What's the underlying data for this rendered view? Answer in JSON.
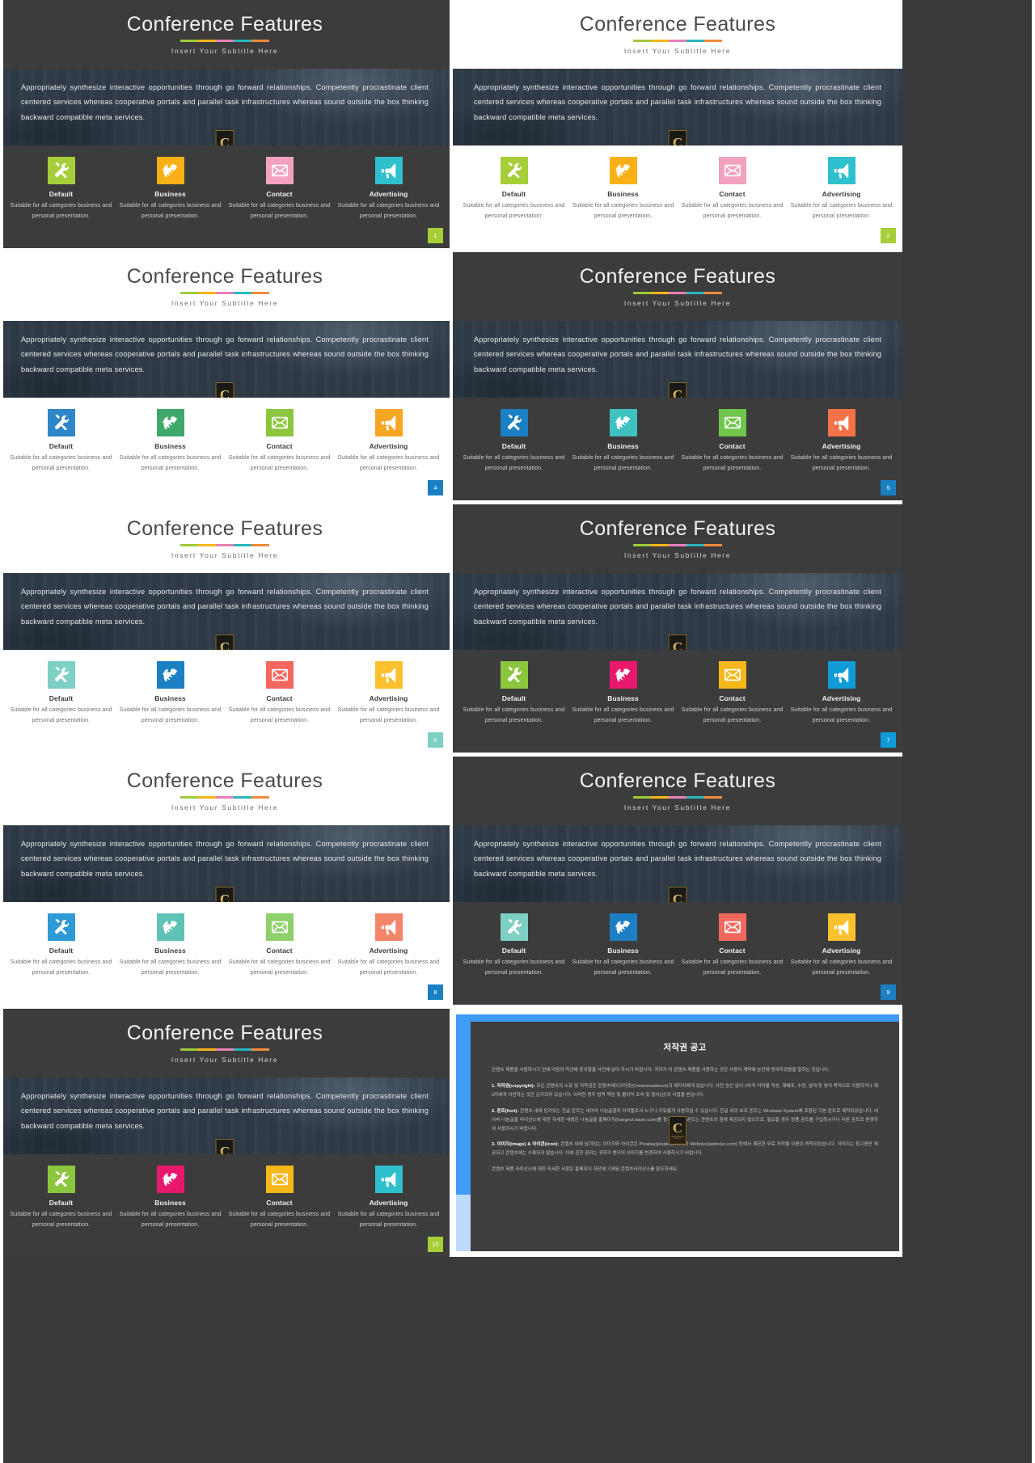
{
  "deck": {
    "title": "Conference Features",
    "subtitle": "Insert Your Subtitle Here",
    "paragraph": "Appropriately synthesize interactive opportunities through go forward relationships. Competently procrastinate client centered services whereas cooperative portals and parallel task infrastructures whereas sound outside the box thinking backward compatible meta services.",
    "watermark": {
      "letter": "C",
      "line1": "CONTENTS",
      "line2": "TAKEOUT"
    },
    "card_labels": [
      "Default",
      "Business",
      "Contact",
      "Advertising"
    ],
    "card_desc": "Suitable for all categories business and personal presentation.",
    "rule_colors": [
      "#9fc93c",
      "#f5b719",
      "#e87fb6",
      "#2bb5bd",
      "#f08a3c"
    ]
  },
  "slides": [
    {
      "number": "1",
      "theme": "dark",
      "page_badge_color": "#a6ce39",
      "icon_colors": [
        "#a6ce39",
        "#f9b016",
        "#f2a2c0",
        "#2fc0cd"
      ]
    },
    {
      "number": "2",
      "theme": "light",
      "page_badge_color": "#a6ce39",
      "icon_colors": [
        "#a6ce39",
        "#f9b016",
        "#f2a2c0",
        "#2fc0cd"
      ]
    },
    {
      "number": "4",
      "theme": "light",
      "page_badge_color": "#1b7fc4",
      "icon_colors": [
        "#2e86c9",
        "#3fa86b",
        "#8cc63f",
        "#f5a623"
      ]
    },
    {
      "number": "5",
      "theme": "dark",
      "page_badge_color": "#1b7fc4",
      "icon_colors": [
        "#1b7fc4",
        "#3ec1bf",
        "#6ec64a",
        "#f4724a"
      ]
    },
    {
      "number": "6",
      "theme": "light",
      "page_badge_color": "#7ecfc4",
      "icon_colors": [
        "#7ecfc4",
        "#1b7fc4",
        "#f2685f",
        "#fbc02d"
      ]
    },
    {
      "number": "7",
      "theme": "dark",
      "page_badge_color": "#0f9bd7",
      "icon_colors": [
        "#8cc63f",
        "#e8196d",
        "#f5b719",
        "#0f9bd7"
      ]
    },
    {
      "number": "8",
      "theme": "light",
      "page_badge_color": "#1b7fc4",
      "icon_colors": [
        "#2e9bd6",
        "#5ec2b5",
        "#8ed06b",
        "#f2856a"
      ]
    },
    {
      "number": "9",
      "theme": "dark",
      "page_badge_color": "#1b7fc4",
      "icon_colors": [
        "#7ecfc4",
        "#1b7fc4",
        "#f2685f",
        "#fbc02d"
      ]
    },
    {
      "number": "10",
      "theme": "dark",
      "page_badge_color": "#a6ce39",
      "icon_colors": [
        "#8cc63f",
        "#e8196d",
        "#f5b719",
        "#2fc0cd"
      ]
    }
  ],
  "copyright": {
    "heading": "저작권 공고",
    "intro": "콘텐츠 제품을 사용하시기 전에 다음의 약관에 동의함을 사전에 읽어 주시기 바랍니다. 귀하가 이 콘텐츠 제품을 사용하는 것은 사용자 계약에 본건에 동의하셨음을 말하는 것입니다.",
    "sections": [
      {
        "label": "1. 저작권(copyright):",
        "text": "모든 콘텐츠의 소유 및 저작권은 콘텐츠테이크아웃(Contentstakeout)과 제작자에게 있습니다. 사전 승인 없이 2차적 저작물 작성, 재배포, 수정, 임대 등 영리 목적으로 이용하거나 제3자에게 이전하는 것은 금지되어 있습니다. 이러한 경우 법적 책임 및 불이익 조치 및 형사(상)의 사법을 받습니다."
      },
      {
        "label": "2. 폰트(font):",
        "text": "콘텐츠 내에 담겨있는 한글 폰트는 네이버 나눔글꼴의 저작물로서 누구나 자유롭게 사용하실 수 있습니다. 한글 외의 보조 폰트는 Windows System에 포함된 기본 폰트로 제작되었습니다. 네이버 나눔글꼴 라이선스에 대한 자세한 내용은 나눔글꼴 홈페이지(hangeul.naver.com)를 참조하세요. 폰트는 콘텐츠의 함께 제공되지 않으므로, 필요할 경우 정품 폰트를 구입하시거나 다른 폰트로 변경하여 사용하시기 바랍니다."
      },
      {
        "label": "3. 이미지(image) & 아이콘(icon):",
        "text": "콘텐츠 내에 담겨있는 이미지와 아이콘은 Pixabay(pixabay.com)와 Webolys(webolys.com) 등에서 제공한 무료 저작물 이용이 허락되었습니다. 이미지는 참고용만 제공되고 콘텐츠에는 수록되지 않습니다. 이에 관한 권리는 귀하가 벤더의 이미지를 변경하여 사용하시기 바랍니다."
      }
    ],
    "footer": "콘텐츠 제품 라이선스에 대한 자세한 사항은 홈페이지 하단에 기재된 콘텐츠라이선스를 참조하세요."
  }
}
